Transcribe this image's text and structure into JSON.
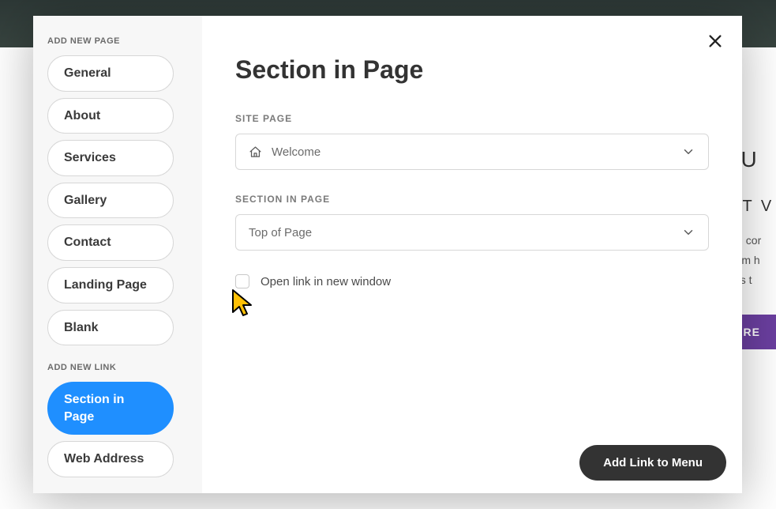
{
  "background": {
    "headline_fragment": "t U",
    "subtitle_fragment": "UT V",
    "body_fragment_1": "wn cor",
    "body_fragment_2": "from h",
    "body_fragment_3": "this t",
    "button_fragment": "MORE"
  },
  "sidebar": {
    "sections": [
      {
        "label": "ADD NEW PAGE",
        "items": [
          {
            "label": "General",
            "active": false
          },
          {
            "label": "About",
            "active": false
          },
          {
            "label": "Services",
            "active": false
          },
          {
            "label": "Gallery",
            "active": false
          },
          {
            "label": "Contact",
            "active": false
          },
          {
            "label": "Landing Page",
            "active": false
          },
          {
            "label": "Blank",
            "active": false
          }
        ]
      },
      {
        "label": "ADD NEW LINK",
        "items": [
          {
            "label": "Section in Page",
            "active": true
          },
          {
            "label": "Web Address",
            "active": false
          }
        ]
      }
    ]
  },
  "main": {
    "title": "Section in Page",
    "site_page": {
      "label": "SITE PAGE",
      "value": "Welcome"
    },
    "section_in_page": {
      "label": "SECTION IN PAGE",
      "value": "Top of Page"
    },
    "checkbox": {
      "label": "Open link in new window",
      "checked": false
    },
    "footer_button": "Add Link to Menu"
  }
}
